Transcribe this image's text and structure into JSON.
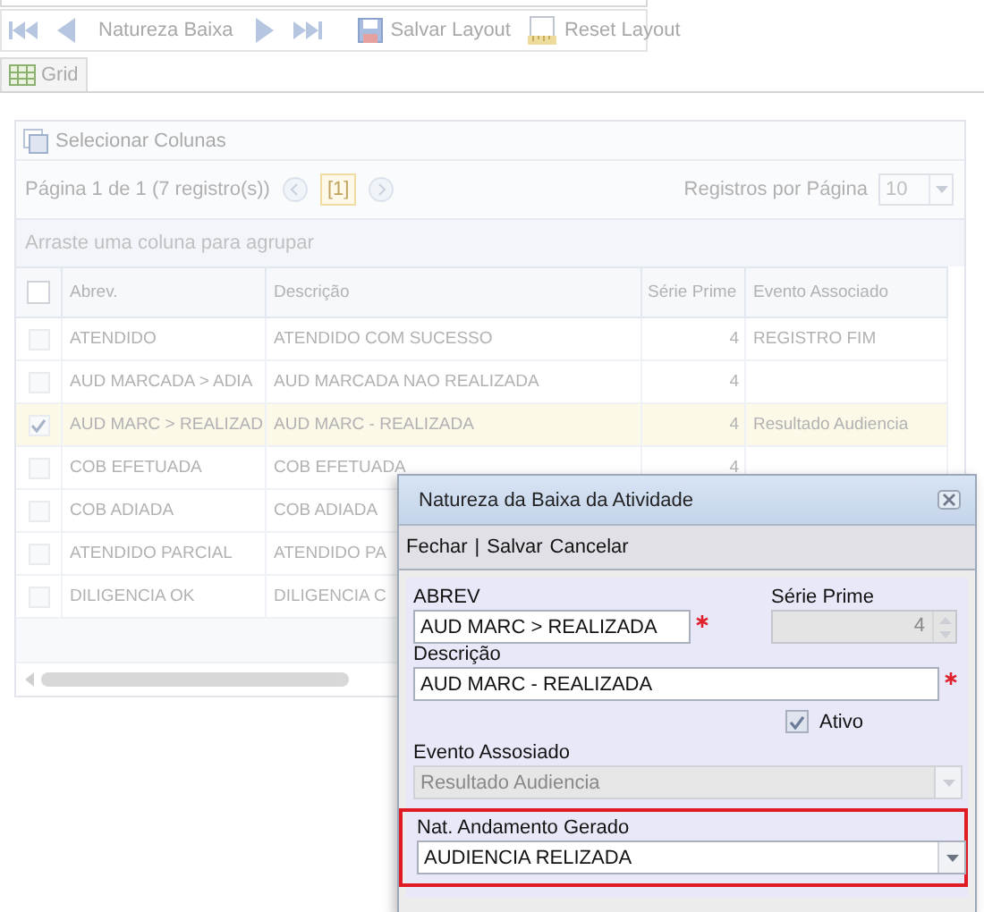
{
  "toolbar": {
    "items": [
      {
        "kind": "first"
      },
      {
        "kind": "prev"
      },
      {
        "kind": "text",
        "label": "Natureza Baixa"
      },
      {
        "kind": "next"
      },
      {
        "kind": "last"
      },
      {
        "kind": "save",
        "label": "Salvar Layout"
      },
      {
        "kind": "reset",
        "label": "Reset Layout"
      }
    ]
  },
  "tabs": [
    {
      "label": "Grid",
      "selected": true
    }
  ],
  "grid": {
    "column_chooser": "Selecionar Colunas",
    "pager_info": "Página 1 de 1 (7 registro(s))",
    "current_page": "[1]",
    "page_size_label": "Registros por Página",
    "page_size": "10",
    "group_hint": "Arraste uma coluna para agrupar",
    "select_all": false,
    "columns": [
      "Abrev.",
      "Descrição",
      "Série Prime",
      "Evento Associado"
    ],
    "rows": [
      {
        "selected": false,
        "cells": [
          "ATENDIDO",
          "ATENDIDO COM SUCESSO",
          "4",
          "REGISTRO FIM"
        ]
      },
      {
        "selected": false,
        "cells": [
          "AUD MARCADA > ADIA",
          "AUD MARCADA NAO REALIZADA",
          "4",
          ""
        ]
      },
      {
        "selected": true,
        "cells": [
          "AUD MARC > REALIZAD",
          "AUD MARC - REALIZADA",
          "4",
          "Resultado Audiencia"
        ]
      },
      {
        "selected": false,
        "cells": [
          "COB EFETUADA",
          "COB EFETUADA",
          "4",
          ""
        ]
      },
      {
        "selected": false,
        "cells": [
          "COB ADIADA",
          "COB ADIADA",
          "",
          ""
        ]
      },
      {
        "selected": false,
        "cells": [
          "ATENDIDO PARCIAL",
          "ATENDIDO PA",
          "",
          ""
        ]
      },
      {
        "selected": false,
        "cells": [
          "DILIGENCIA OK",
          "DILIGENCIA C",
          "",
          ""
        ]
      }
    ]
  },
  "dialog": {
    "title": "Natureza da Baixa da Atividade",
    "actions": [
      "Fechar",
      "Salvar",
      "Cancelar"
    ],
    "action_separator": "|",
    "abrev": {
      "label": "ABREV",
      "value": "AUD MARC > REALIZADA",
      "required": true
    },
    "serie": {
      "label": "Série Prime",
      "value": "4",
      "disabled": true
    },
    "descricao": {
      "label": "Descrição",
      "value": "AUD MARC - REALIZADA",
      "required": true
    },
    "ativo": {
      "label": "Ativo",
      "checked": true
    },
    "evento": {
      "label": "Evento Assosiado",
      "value": "Resultado Audiencia",
      "disabled": true
    },
    "nat_andamento": {
      "label": "Nat. Andamento Gerado",
      "value": "AUDIENCIA RELIZADA",
      "highlighted": true
    }
  }
}
